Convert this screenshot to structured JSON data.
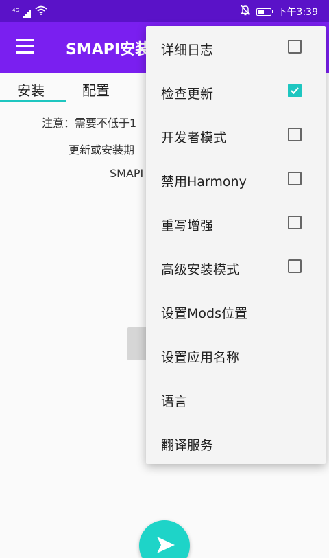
{
  "status_bar": {
    "network": "4G",
    "time": "下午3:39",
    "battery_level": 0.55
  },
  "toolbar": {
    "title": "SMAPI安装"
  },
  "tabs": [
    {
      "label": "安装",
      "selected": true
    },
    {
      "label": "配置",
      "selected": false
    }
  ],
  "content": {
    "line1": "注意：需要不低于1",
    "line2": "更新或安装期",
    "line3": "SMAPI"
  },
  "menu": {
    "items": [
      {
        "label": "详细日志",
        "has_checkbox": true,
        "checked": false
      },
      {
        "label": "检查更新",
        "has_checkbox": true,
        "checked": true
      },
      {
        "label": "开发者模式",
        "has_checkbox": true,
        "checked": false
      },
      {
        "label": "禁用Harmony",
        "has_checkbox": true,
        "checked": false
      },
      {
        "label": "重写增强",
        "has_checkbox": true,
        "checked": false
      },
      {
        "label": "高级安装模式",
        "has_checkbox": true,
        "checked": false
      },
      {
        "label": "设置Mods位置",
        "has_checkbox": false,
        "checked": false
      },
      {
        "label": "设置应用名称",
        "has_checkbox": false,
        "checked": false
      },
      {
        "label": "语言",
        "has_checkbox": false,
        "checked": false
      },
      {
        "label": "翻译服务",
        "has_checkbox": false,
        "checked": false
      }
    ]
  },
  "colors": {
    "status_bar": "#5a12c8",
    "toolbar": "#7a1ff0",
    "accent": "#1ec6c0",
    "fab": "#1ed4c8"
  },
  "icons": {
    "menu": "hamburger-menu-icon",
    "fab": "send-icon",
    "checked": "check-icon"
  }
}
